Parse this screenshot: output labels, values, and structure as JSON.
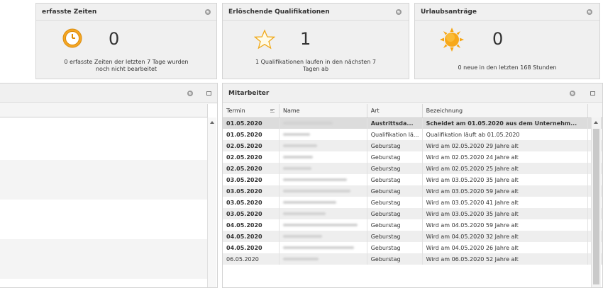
{
  "tiles": {
    "zeiten": {
      "title": "erfasste Zeiten",
      "count": "0",
      "text_line1": "0 erfasste Zeiten der letzten 7 Tage wurden",
      "text_line2": "noch nicht bearbeitet",
      "icon": "clock-icon"
    },
    "qualifikationen": {
      "title": "Erlöschende Qualifikationen",
      "count": "1",
      "text_line1": "1 Qualifikationen laufen in den nächsten  7",
      "text_line2": "Tagen ab",
      "icon": "star-icon"
    },
    "urlaub": {
      "title": "Urlaubsanträge",
      "count": "0",
      "text_line1": "0 neue in den letzten 168 Stunden",
      "icon": "sun-icon"
    }
  },
  "mitarbeiter": {
    "title": "Mitarbeiter",
    "columns": {
      "termin": "Termin",
      "name": "Name",
      "art": "Art",
      "bezeichnung": "Bezeichnung"
    },
    "rows": [
      {
        "termin": "01.05.2020",
        "art": "Austrittsda...",
        "bezeichnung": "Scheidet am 01.05.2020 aus dem Unternehm..."
      },
      {
        "termin": "01.05.2020",
        "art": "Qualifikation lä...",
        "bezeichnung": "Qualifikation läuft ab 01.05.2020"
      },
      {
        "termin": "02.05.2020",
        "art": "Geburstag",
        "bezeichnung": "Wird am 02.05.2020 29 Jahre alt"
      },
      {
        "termin": "02.05.2020",
        "art": "Geburstag",
        "bezeichnung": "Wird am 02.05.2020 24 Jahre alt"
      },
      {
        "termin": "02.05.2020",
        "art": "Geburstag",
        "bezeichnung": "Wird am 02.05.2020 25 Jahre alt"
      },
      {
        "termin": "03.05.2020",
        "art": "Geburstag",
        "bezeichnung": "Wird am 03.05.2020 35 Jahre alt"
      },
      {
        "termin": "03.05.2020",
        "art": "Geburstag",
        "bezeichnung": "Wird am 03.05.2020 59 Jahre alt"
      },
      {
        "termin": "03.05.2020",
        "art": "Geburstag",
        "bezeichnung": "Wird am 03.05.2020 41 Jahre alt"
      },
      {
        "termin": "03.05.2020",
        "art": "Geburstag",
        "bezeichnung": "Wird am 03.05.2020 35 Jahre alt"
      },
      {
        "termin": "04.05.2020",
        "art": "Geburstag",
        "bezeichnung": "Wird am 04.05.2020 59 Jahre alt"
      },
      {
        "termin": "04.05.2020",
        "art": "Geburstag",
        "bezeichnung": "Wird am 04.05.2020 32 Jahre alt"
      },
      {
        "termin": "04.05.2020",
        "art": "Geburstag",
        "bezeichnung": "Wird am 04.05.2020 26 Jahre alt"
      },
      {
        "termin": "06.05.2020",
        "art": "Geburstag",
        "bezeichnung": "Wird am 06.05.2020 52 Jahre alt"
      }
    ]
  },
  "colors": {
    "accent_orange": "#f5a623",
    "tile_bg": "#f0f0f0",
    "border": "#d4d4d4"
  }
}
